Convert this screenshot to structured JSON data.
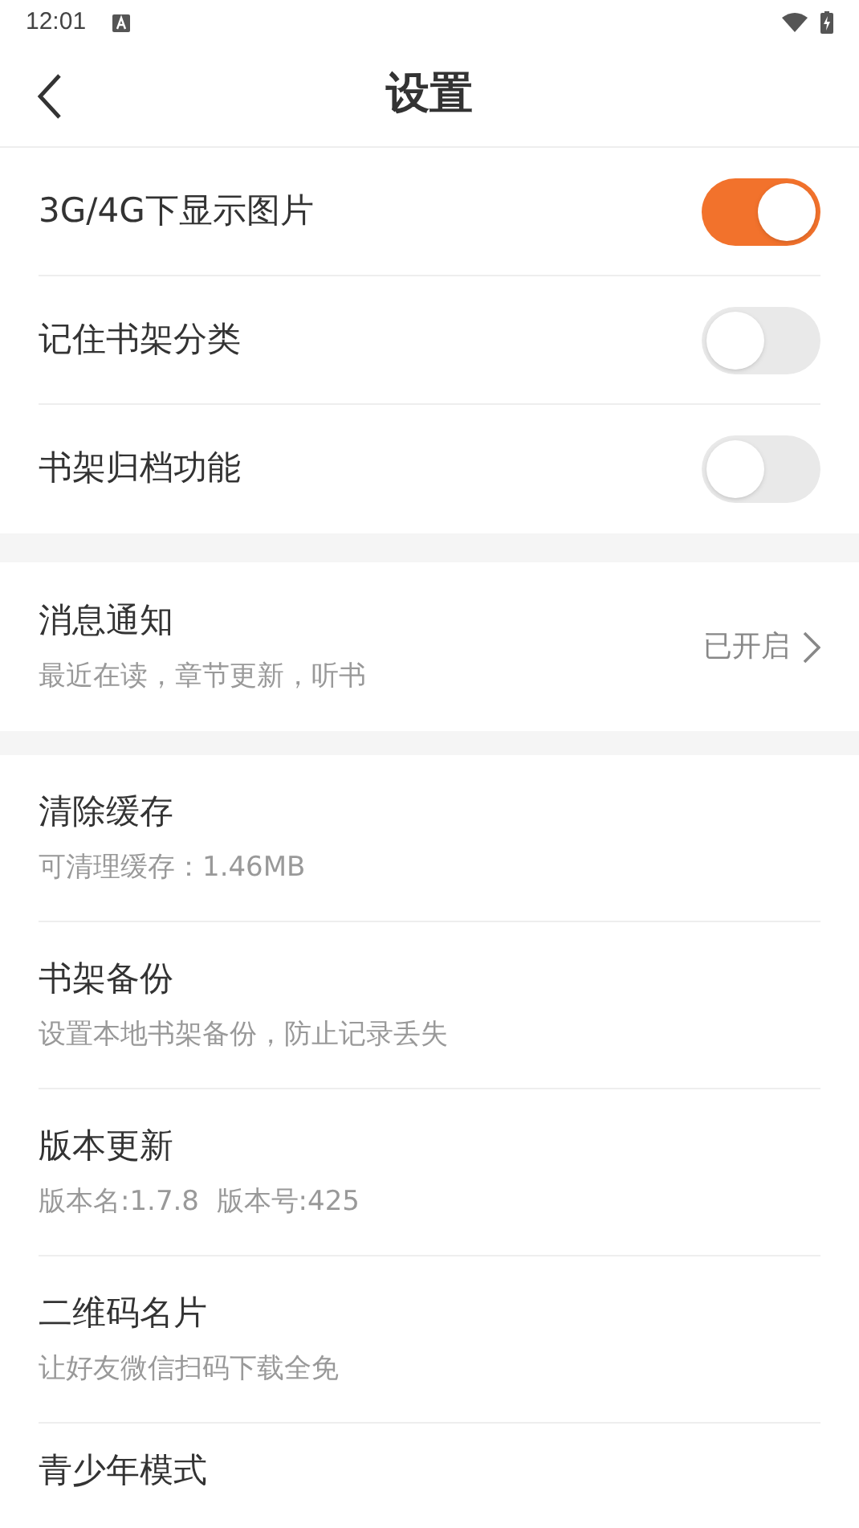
{
  "status_bar": {
    "time": "12:01"
  },
  "header": {
    "title": "设置"
  },
  "toggles": [
    {
      "label": "3G/4G下显示图片",
      "on": true
    },
    {
      "label": "记住书架分类",
      "on": false
    },
    {
      "label": "书架归档功能",
      "on": false
    }
  ],
  "notification": {
    "title": "消息通知",
    "subtitle": "最近在读，章节更新，听书",
    "value": "已开启"
  },
  "items": [
    {
      "title": "清除缓存",
      "subtitle": "可清理缓存：1.46MB"
    },
    {
      "title": "书架备份",
      "subtitle": "设置本地书架备份，防止记录丢失"
    },
    {
      "title": "版本更新",
      "subtitle": "版本名:1.7.8  版本号:425"
    },
    {
      "title": "二维码名片",
      "subtitle": "让好友微信扫码下载全免"
    },
    {
      "title": "青少年模式"
    }
  ]
}
